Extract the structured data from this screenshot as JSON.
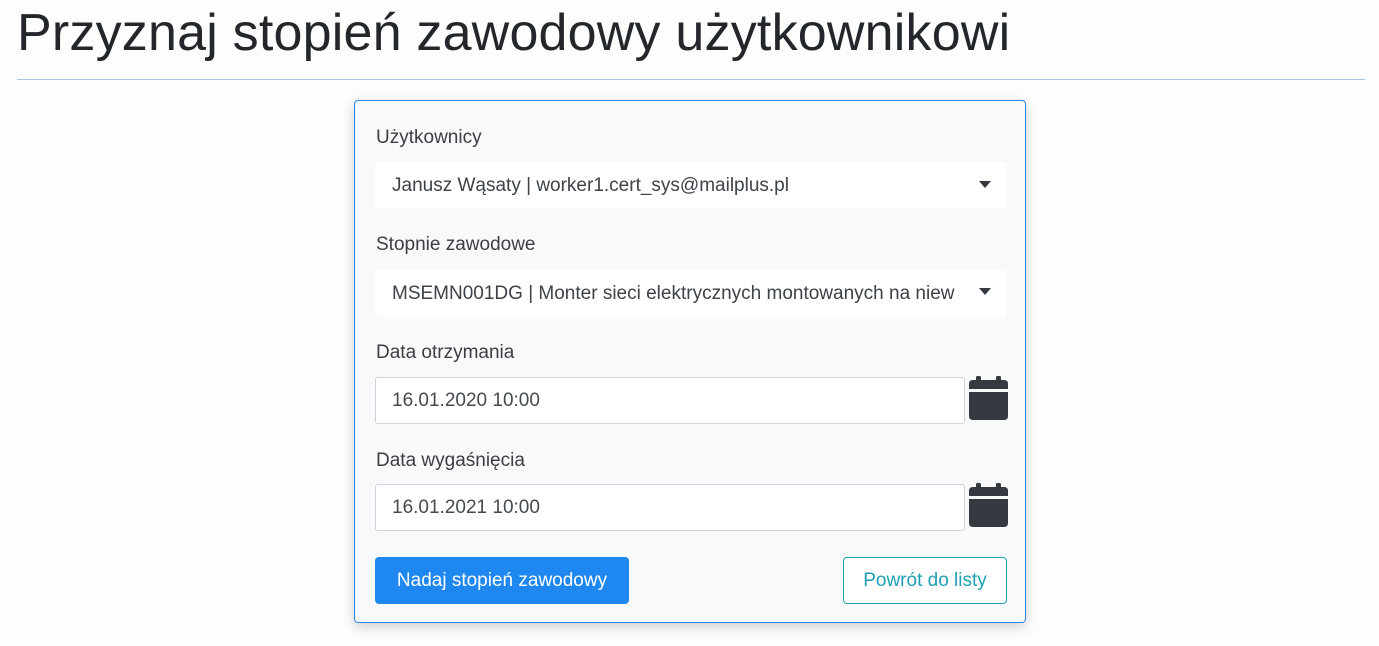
{
  "page": {
    "title": "Przyznaj stopień zawodowy użytkownikowi"
  },
  "form": {
    "users": {
      "label": "Użytkownicy",
      "selected": "Janusz Wąsaty | worker1.cert_sys@mailplus.pl"
    },
    "degrees": {
      "label": "Stopnie zawodowe",
      "selected": "MSEMN001DG | Monter sieci elektrycznych montowanych na niew"
    },
    "received_date": {
      "label": "Data otrzymania",
      "value": "16.01.2020 10:00",
      "icon": "calendar-icon"
    },
    "expiry_date": {
      "label": "Data wygaśnięcia",
      "value": "16.01.2021 10:00",
      "icon": "calendar-icon"
    },
    "submit_label": "Nadaj stopień zawodowy",
    "back_label": "Powrót do listy"
  },
  "colors": {
    "primary": "#1e88f0",
    "outline_info": "#20a0b4",
    "card_border": "#2f86e6",
    "icon": "#343a40"
  }
}
